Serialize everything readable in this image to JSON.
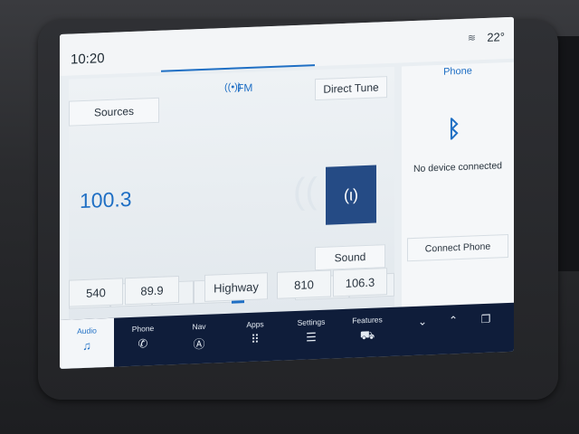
{
  "status": {
    "time": "10:20",
    "temperature": "22°"
  },
  "radio": {
    "band": "FM",
    "sources_label": "Sources",
    "direct_tune_label": "Direct Tune",
    "frequency": "100.3",
    "sound_label": "Sound",
    "controls": [
      "⏮",
      "−",
      "+",
      "⏭",
      "",
      "106.3"
    ],
    "presets": [
      "540",
      "89.9",
      "Highway",
      "810",
      "106.3"
    ]
  },
  "phone": {
    "title": "Phone",
    "status_text": "No device connected",
    "connect_label": "Connect Phone"
  },
  "nav": {
    "items": [
      {
        "label": "Audio",
        "icon": "♫"
      },
      {
        "label": "Phone",
        "icon": "✆"
      },
      {
        "label": "Nav",
        "icon": "Ⓐ"
      },
      {
        "label": "Apps",
        "icon": "⠿"
      },
      {
        "label": "Settings",
        "icon": "☰"
      },
      {
        "label": "Features",
        "icon": "⛟"
      }
    ]
  },
  "colors": {
    "accent": "#1f6fc4",
    "navbar": "#0f1d3a",
    "tile": "#254b85"
  }
}
